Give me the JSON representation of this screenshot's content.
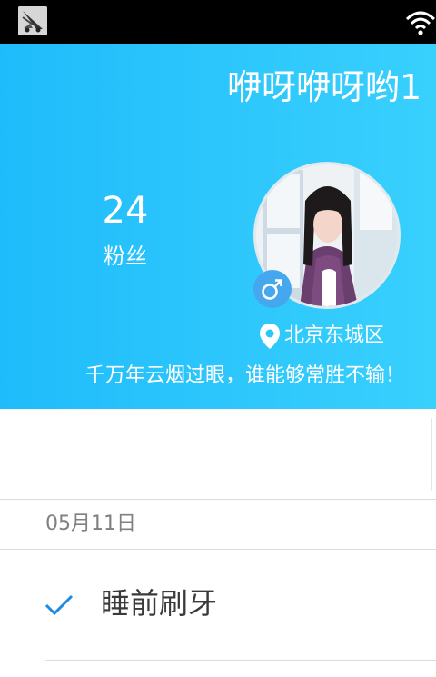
{
  "status_bar": {
    "app_icon": "app-notification-icon",
    "wifi_icon": "wifi-icon"
  },
  "profile": {
    "nickname": "咿呀咿呀哟1",
    "fans_count": "24",
    "fans_label": "粉丝",
    "avatar": "user-avatar",
    "gender_icon": "male-icon",
    "location": "北京东城区",
    "signature": "千万年云烟过眼，谁能够常胜不输！"
  },
  "timeline": {
    "date": "05月11日",
    "tasks": [
      {
        "title": "睡前刷牙",
        "status_icon": "checkmark-icon"
      }
    ]
  },
  "colors": {
    "header_gradient_start": "#1fbcfb",
    "header_gradient_end": "#38d0fd",
    "gender_badge": "#45a8ee",
    "check_accent": "#1e8be0"
  }
}
